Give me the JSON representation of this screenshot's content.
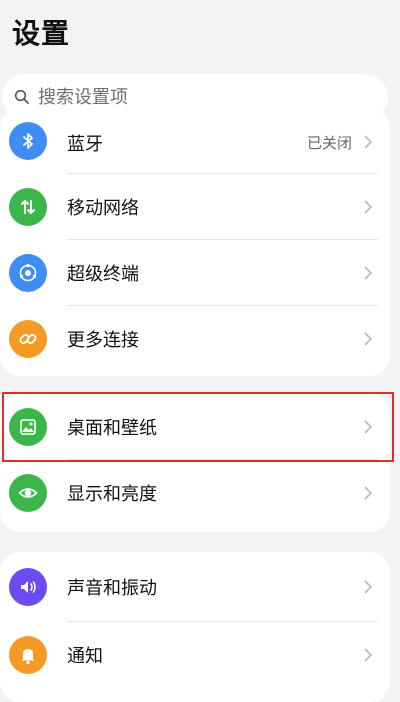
{
  "header": {
    "title": "设置"
  },
  "search": {
    "placeholder": "搜索设置项"
  },
  "groups": [
    {
      "items": [
        {
          "label": "蓝牙",
          "value": "已关闭",
          "icon": "bluetooth-icon",
          "color": "#3d8df5"
        },
        {
          "label": "移动网络",
          "value": "",
          "icon": "mobile-network-icon",
          "color": "#3cb54a"
        },
        {
          "label": "超级终端",
          "value": "",
          "icon": "super-device-icon",
          "color": "#3d8df5"
        },
        {
          "label": "更多连接",
          "value": "",
          "icon": "link-icon",
          "color": "#f59a24"
        }
      ]
    },
    {
      "items": [
        {
          "label": "桌面和壁纸",
          "value": "",
          "icon": "wallpaper-icon",
          "color": "#3cb54a"
        },
        {
          "label": "显示和亮度",
          "value": "",
          "icon": "eye-icon",
          "color": "#3cb54a"
        }
      ]
    },
    {
      "items": [
        {
          "label": "声音和振动",
          "value": "",
          "icon": "sound-icon",
          "color": "#6a4cf0"
        },
        {
          "label": "通知",
          "value": "",
          "icon": "bell-icon",
          "color": "#f59a24"
        }
      ]
    }
  ],
  "highlight_color": "#e52b2b"
}
